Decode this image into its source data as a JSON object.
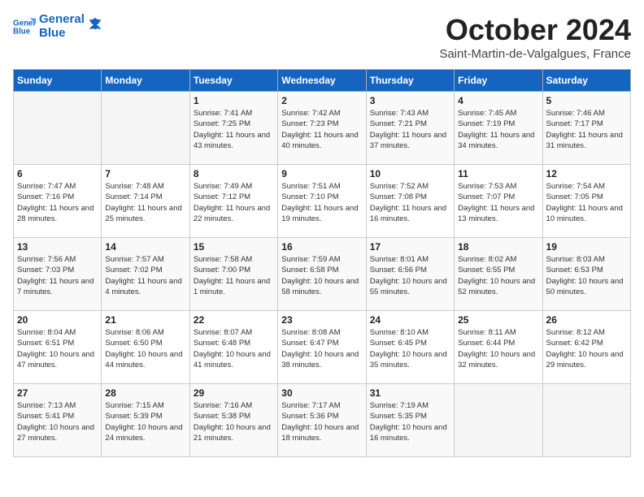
{
  "header": {
    "logo_line1": "General",
    "logo_line2": "Blue",
    "month": "October 2024",
    "location": "Saint-Martin-de-Valgalgues, France"
  },
  "weekdays": [
    "Sunday",
    "Monday",
    "Tuesday",
    "Wednesday",
    "Thursday",
    "Friday",
    "Saturday"
  ],
  "weeks": [
    [
      {
        "day": "",
        "sunrise": "",
        "sunset": "",
        "daylight": ""
      },
      {
        "day": "",
        "sunrise": "",
        "sunset": "",
        "daylight": ""
      },
      {
        "day": "1",
        "sunrise": "Sunrise: 7:41 AM",
        "sunset": "Sunset: 7:25 PM",
        "daylight": "Daylight: 11 hours and 43 minutes."
      },
      {
        "day": "2",
        "sunrise": "Sunrise: 7:42 AM",
        "sunset": "Sunset: 7:23 PM",
        "daylight": "Daylight: 11 hours and 40 minutes."
      },
      {
        "day": "3",
        "sunrise": "Sunrise: 7:43 AM",
        "sunset": "Sunset: 7:21 PM",
        "daylight": "Daylight: 11 hours and 37 minutes."
      },
      {
        "day": "4",
        "sunrise": "Sunrise: 7:45 AM",
        "sunset": "Sunset: 7:19 PM",
        "daylight": "Daylight: 11 hours and 34 minutes."
      },
      {
        "day": "5",
        "sunrise": "Sunrise: 7:46 AM",
        "sunset": "Sunset: 7:17 PM",
        "daylight": "Daylight: 11 hours and 31 minutes."
      }
    ],
    [
      {
        "day": "6",
        "sunrise": "Sunrise: 7:47 AM",
        "sunset": "Sunset: 7:16 PM",
        "daylight": "Daylight: 11 hours and 28 minutes."
      },
      {
        "day": "7",
        "sunrise": "Sunrise: 7:48 AM",
        "sunset": "Sunset: 7:14 PM",
        "daylight": "Daylight: 11 hours and 25 minutes."
      },
      {
        "day": "8",
        "sunrise": "Sunrise: 7:49 AM",
        "sunset": "Sunset: 7:12 PM",
        "daylight": "Daylight: 11 hours and 22 minutes."
      },
      {
        "day": "9",
        "sunrise": "Sunrise: 7:51 AM",
        "sunset": "Sunset: 7:10 PM",
        "daylight": "Daylight: 11 hours and 19 minutes."
      },
      {
        "day": "10",
        "sunrise": "Sunrise: 7:52 AM",
        "sunset": "Sunset: 7:08 PM",
        "daylight": "Daylight: 11 hours and 16 minutes."
      },
      {
        "day": "11",
        "sunrise": "Sunrise: 7:53 AM",
        "sunset": "Sunset: 7:07 PM",
        "daylight": "Daylight: 11 hours and 13 minutes."
      },
      {
        "day": "12",
        "sunrise": "Sunrise: 7:54 AM",
        "sunset": "Sunset: 7:05 PM",
        "daylight": "Daylight: 11 hours and 10 minutes."
      }
    ],
    [
      {
        "day": "13",
        "sunrise": "Sunrise: 7:56 AM",
        "sunset": "Sunset: 7:03 PM",
        "daylight": "Daylight: 11 hours and 7 minutes."
      },
      {
        "day": "14",
        "sunrise": "Sunrise: 7:57 AM",
        "sunset": "Sunset: 7:02 PM",
        "daylight": "Daylight: 11 hours and 4 minutes."
      },
      {
        "day": "15",
        "sunrise": "Sunrise: 7:58 AM",
        "sunset": "Sunset: 7:00 PM",
        "daylight": "Daylight: 11 hours and 1 minute."
      },
      {
        "day": "16",
        "sunrise": "Sunrise: 7:59 AM",
        "sunset": "Sunset: 6:58 PM",
        "daylight": "Daylight: 10 hours and 58 minutes."
      },
      {
        "day": "17",
        "sunrise": "Sunrise: 8:01 AM",
        "sunset": "Sunset: 6:56 PM",
        "daylight": "Daylight: 10 hours and 55 minutes."
      },
      {
        "day": "18",
        "sunrise": "Sunrise: 8:02 AM",
        "sunset": "Sunset: 6:55 PM",
        "daylight": "Daylight: 10 hours and 52 minutes."
      },
      {
        "day": "19",
        "sunrise": "Sunrise: 8:03 AM",
        "sunset": "Sunset: 6:53 PM",
        "daylight": "Daylight: 10 hours and 50 minutes."
      }
    ],
    [
      {
        "day": "20",
        "sunrise": "Sunrise: 8:04 AM",
        "sunset": "Sunset: 6:51 PM",
        "daylight": "Daylight: 10 hours and 47 minutes."
      },
      {
        "day": "21",
        "sunrise": "Sunrise: 8:06 AM",
        "sunset": "Sunset: 6:50 PM",
        "daylight": "Daylight: 10 hours and 44 minutes."
      },
      {
        "day": "22",
        "sunrise": "Sunrise: 8:07 AM",
        "sunset": "Sunset: 6:48 PM",
        "daylight": "Daylight: 10 hours and 41 minutes."
      },
      {
        "day": "23",
        "sunrise": "Sunrise: 8:08 AM",
        "sunset": "Sunset: 6:47 PM",
        "daylight": "Daylight: 10 hours and 38 minutes."
      },
      {
        "day": "24",
        "sunrise": "Sunrise: 8:10 AM",
        "sunset": "Sunset: 6:45 PM",
        "daylight": "Daylight: 10 hours and 35 minutes."
      },
      {
        "day": "25",
        "sunrise": "Sunrise: 8:11 AM",
        "sunset": "Sunset: 6:44 PM",
        "daylight": "Daylight: 10 hours and 32 minutes."
      },
      {
        "day": "26",
        "sunrise": "Sunrise: 8:12 AM",
        "sunset": "Sunset: 6:42 PM",
        "daylight": "Daylight: 10 hours and 29 minutes."
      }
    ],
    [
      {
        "day": "27",
        "sunrise": "Sunrise: 7:13 AM",
        "sunset": "Sunset: 5:41 PM",
        "daylight": "Daylight: 10 hours and 27 minutes."
      },
      {
        "day": "28",
        "sunrise": "Sunrise: 7:15 AM",
        "sunset": "Sunset: 5:39 PM",
        "daylight": "Daylight: 10 hours and 24 minutes."
      },
      {
        "day": "29",
        "sunrise": "Sunrise: 7:16 AM",
        "sunset": "Sunset: 5:38 PM",
        "daylight": "Daylight: 10 hours and 21 minutes."
      },
      {
        "day": "30",
        "sunrise": "Sunrise: 7:17 AM",
        "sunset": "Sunset: 5:36 PM",
        "daylight": "Daylight: 10 hours and 18 minutes."
      },
      {
        "day": "31",
        "sunrise": "Sunrise: 7:19 AM",
        "sunset": "Sunset: 5:35 PM",
        "daylight": "Daylight: 10 hours and 16 minutes."
      },
      {
        "day": "",
        "sunrise": "",
        "sunset": "",
        "daylight": ""
      },
      {
        "day": "",
        "sunrise": "",
        "sunset": "",
        "daylight": ""
      }
    ]
  ]
}
